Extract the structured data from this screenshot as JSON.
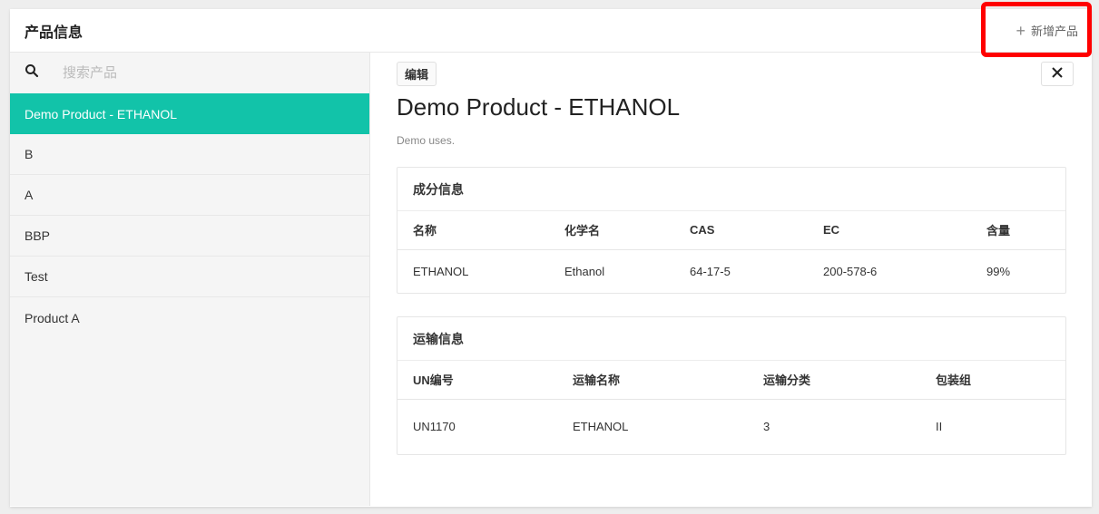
{
  "header": {
    "title": "产品信息",
    "add_button_label": "新增产品",
    "add_icon": "+"
  },
  "sidebar": {
    "search_placeholder": "搜索产品",
    "items": [
      {
        "label": "Demo Product - ETHANOL",
        "active": true
      },
      {
        "label": "B"
      },
      {
        "label": "A"
      },
      {
        "label": "BBP"
      },
      {
        "label": "Test"
      },
      {
        "label": "Product A"
      }
    ]
  },
  "detail": {
    "edit_label": "编辑",
    "title": "Demo Product - ETHANOL",
    "description": "Demo uses.",
    "composition": {
      "title": "成分信息",
      "columns": [
        "名称",
        "化学名",
        "CAS",
        "EC",
        "含量"
      ],
      "rows": [
        [
          "ETHANOL",
          "Ethanol",
          "64-17-5",
          "200-578-6",
          "99%"
        ]
      ]
    },
    "transport": {
      "title": "运输信息",
      "columns": [
        "UN编号",
        "运输名称",
        "运输分类",
        "包装组"
      ],
      "rows": [
        [
          "UN1170",
          "ETHANOL",
          "3",
          "II"
        ]
      ]
    }
  },
  "colors": {
    "accent": "#12c3a9",
    "highlight": "#ff0000"
  }
}
